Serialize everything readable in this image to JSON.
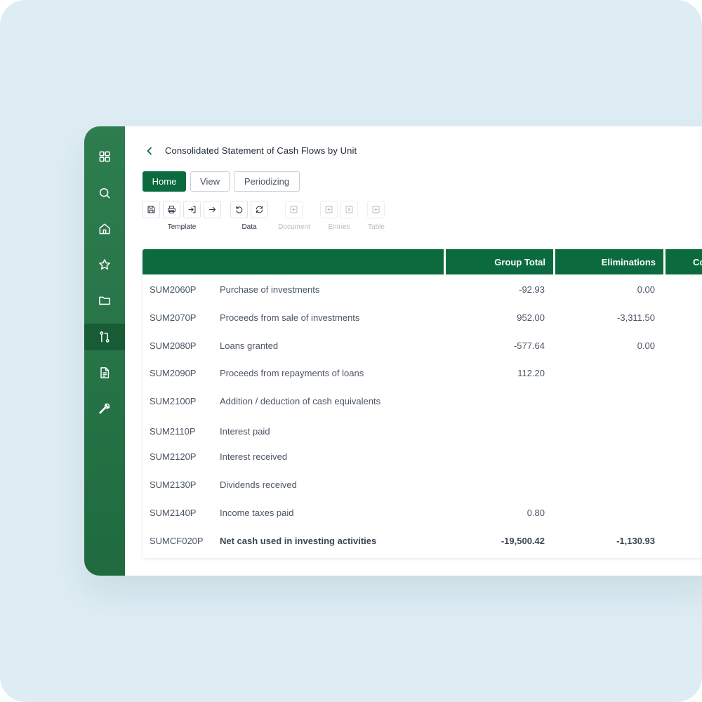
{
  "window": {
    "title": "Consolidated Statement of Cash Flows by Unit"
  },
  "sidebar": {
    "items": [
      {
        "icon": "grid-icon",
        "active": false
      },
      {
        "icon": "search-icon",
        "active": false
      },
      {
        "icon": "home-icon",
        "active": false
      },
      {
        "icon": "star-icon",
        "active": false
      },
      {
        "icon": "folder-icon",
        "active": false
      },
      {
        "icon": "git-compare-icon",
        "active": true
      },
      {
        "icon": "document-icon",
        "active": false
      },
      {
        "icon": "wrench-icon",
        "active": false
      }
    ]
  },
  "tabs": [
    {
      "label": "Home",
      "active": true
    },
    {
      "label": "View",
      "active": false
    },
    {
      "label": "Periodizing",
      "active": false
    }
  ],
  "toolbar": {
    "groups": [
      {
        "label": "Template",
        "enabled": true,
        "buttons": [
          "save-icon",
          "print-icon",
          "import-icon",
          "arrow-right-icon"
        ]
      },
      {
        "label": "Data",
        "enabled": true,
        "buttons": [
          "undo-icon",
          "refresh-icon"
        ]
      },
      {
        "label": "Document",
        "enabled": false,
        "buttons": [
          "add-box-icon"
        ]
      },
      {
        "label": "Entries",
        "enabled": false,
        "buttons": [
          "add-box-icon",
          "delete-box-icon"
        ]
      },
      {
        "label": "Table",
        "enabled": false,
        "buttons": [
          "add-box-icon"
        ]
      }
    ]
  },
  "table": {
    "columns": [
      "",
      "Group Total",
      "Eliminations",
      "Co"
    ],
    "rows": [
      {
        "code": "SUM2060P",
        "description": "Purchase of investments",
        "group_total": "-92.93",
        "eliminations": "0.00"
      },
      {
        "code": "SUM2070P",
        "description": "Proceeds from sale of investments",
        "group_total": "952.00",
        "eliminations": "-3,311.50"
      },
      {
        "code": "SUM2080P",
        "description": "Loans granted",
        "group_total": "-577.64",
        "eliminations": "0.00"
      },
      {
        "code": "SUM2090P",
        "description": "Proceeds from repayments of loans",
        "group_total": "112.20",
        "eliminations": ""
      },
      {
        "code": "SUM2100P",
        "description": "Addition / deduction of cash equivalents",
        "group_total": "",
        "eliminations": ""
      },
      {
        "code": "SUM2110P",
        "description": "Interest paid",
        "group_total": "",
        "eliminations": ""
      },
      {
        "code": "SUM2120P",
        "description": "Interest received",
        "group_total": "",
        "eliminations": ""
      },
      {
        "code": "SUM2130P",
        "description": "Dividends received",
        "group_total": "",
        "eliminations": ""
      },
      {
        "code": "SUM2140P",
        "description": "Income taxes paid",
        "group_total": "0.80",
        "eliminations": ""
      },
      {
        "code": "SUMCF020P",
        "description": "Net cash used in investing activities",
        "group_total": "-19,500.42",
        "eliminations": "-1,130.93",
        "total": true
      }
    ]
  },
  "colors": {
    "brand_green": "#0b6b3f",
    "sidebar_green": "#2e7d4f",
    "sidebar_active": "#175c34",
    "backdrop": "#deedf4"
  }
}
